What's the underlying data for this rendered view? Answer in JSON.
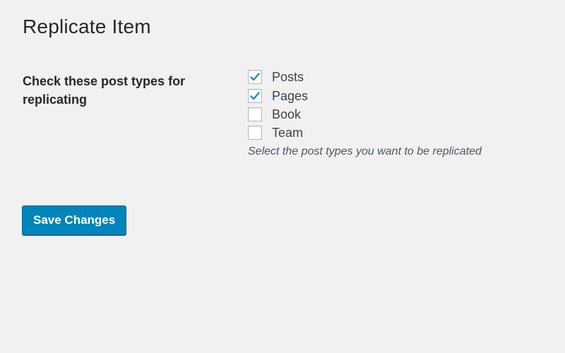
{
  "page": {
    "title": "Replicate Item"
  },
  "setting": {
    "label": "Check these post types for replicating",
    "options": [
      {
        "label": "Posts",
        "checked": true
      },
      {
        "label": "Pages",
        "checked": true
      },
      {
        "label": "Book",
        "checked": false
      },
      {
        "label": "Team",
        "checked": false
      }
    ],
    "description": "Select the post types you want to be replicated"
  },
  "actions": {
    "save_label": "Save Changes"
  },
  "colors": {
    "background": "#f1f1f1",
    "primary_button": "#0085ba",
    "checkmark": "#1e8cbe"
  }
}
